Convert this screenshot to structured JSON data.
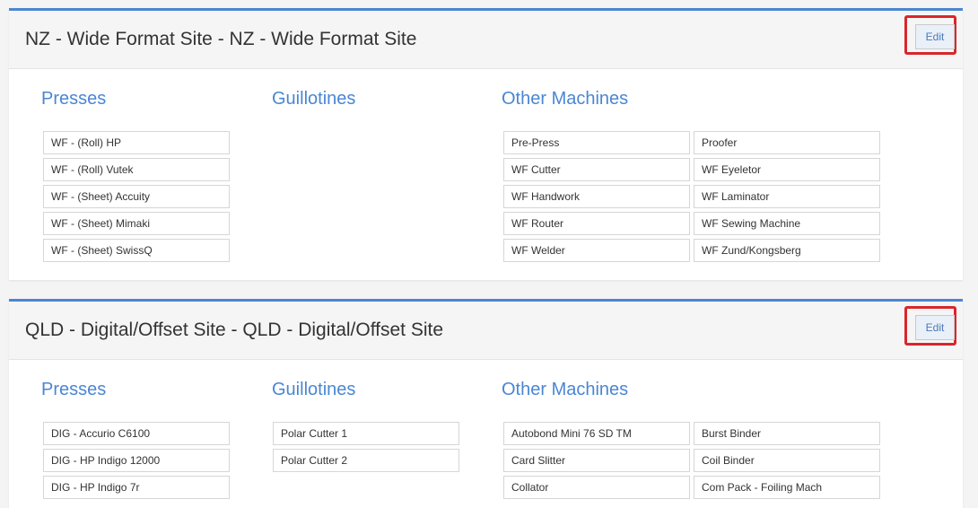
{
  "panels": [
    {
      "title": "NZ - Wide Format Site - NZ - Wide Format Site",
      "edit_label": "Edit",
      "presses_heading": "Presses",
      "guillotines_heading": "Guillotines",
      "other_heading": "Other Machines",
      "presses": [
        "WF - (Roll) HP",
        "WF - (Roll) Vutek",
        "WF - (Sheet) Accuity",
        "WF - (Sheet) Mimaki",
        "WF - (Sheet) SwissQ"
      ],
      "guillotines": [],
      "other_left": [
        "Pre-Press",
        "WF Cutter",
        "WF Handwork",
        "WF Router",
        "WF Welder"
      ],
      "other_right": [
        "Proofer",
        "WF Eyeletor",
        "WF Laminator",
        "WF Sewing Machine",
        "WF Zund/Kongsberg"
      ]
    },
    {
      "title": "QLD - Digital/Offset Site - QLD - Digital/Offset Site",
      "edit_label": "Edit",
      "presses_heading": "Presses",
      "guillotines_heading": "Guillotines",
      "other_heading": "Other Machines",
      "presses": [
        "DIG - Accurio C6100",
        "DIG - HP Indigo 12000",
        "DIG - HP Indigo 7r"
      ],
      "guillotines": [
        "Polar Cutter 1",
        "Polar Cutter 2"
      ],
      "other_left": [
        "Autobond Mini 76 SD TM",
        "Card Slitter",
        "Collator"
      ],
      "other_right": [
        "Burst Binder",
        "Coil Binder",
        "Com Pack - Foiling Mach"
      ]
    }
  ],
  "colors": {
    "accent": "#4a86d3",
    "highlight_border": "#d9262b"
  }
}
